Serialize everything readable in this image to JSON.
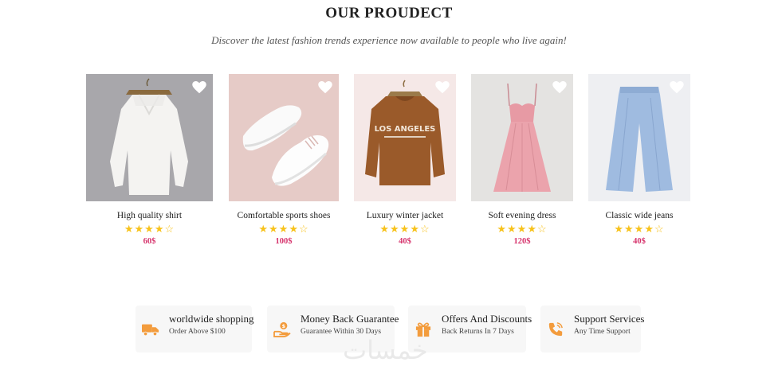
{
  "section": {
    "title": "OUR PROUDECT",
    "subtitle": "Discover the latest fashion trends experience now available to people who live again!"
  },
  "colors": {
    "star": "#f7c21b",
    "price": "#d6336c",
    "icon": "#f39c3d",
    "feature_bg": "#f7f7f7"
  },
  "products": [
    {
      "name": "High quality shirt",
      "price": "60$",
      "rating": 4,
      "max_rating": 5,
      "image": "white-blouse-image"
    },
    {
      "name": "Comfortable sports shoes",
      "price": "100$",
      "rating": 4,
      "max_rating": 5,
      "image": "white-sneakers-image"
    },
    {
      "name": "Luxury winter jacket",
      "price": "40$",
      "rating": 4,
      "max_rating": 5,
      "image": "brown-sweatshirt-image"
    },
    {
      "name": "Soft evening dress",
      "price": "120$",
      "rating": 4,
      "max_rating": 5,
      "image": "pink-dress-image"
    },
    {
      "name": "Classic wide jeans",
      "price": "40$",
      "rating": 4,
      "max_rating": 5,
      "image": "blue-trousers-image"
    }
  ],
  "features": [
    {
      "title": "worldwide shopping",
      "subtitle": "Order Above $100",
      "icon": "truck-icon"
    },
    {
      "title": "Money Back Guarantee",
      "subtitle": "Guarantee Within 30 Days",
      "icon": "money-hand-icon"
    },
    {
      "title": "Offers And Discounts",
      "subtitle": "Back Returns In 7 Days",
      "icon": "gift-icon"
    },
    {
      "title": "Support Services",
      "subtitle": "Any Time Support",
      "icon": "phone-icon"
    }
  ],
  "watermark": "خمسات"
}
